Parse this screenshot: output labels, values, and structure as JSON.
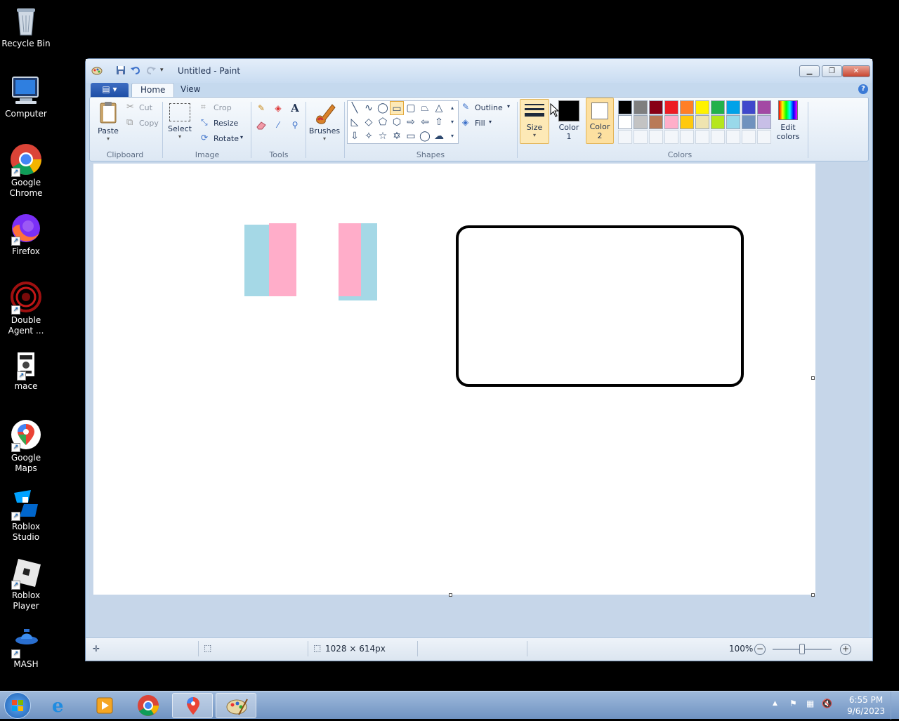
{
  "desktop": {
    "icons": [
      {
        "label": "Recycle Bin"
      },
      {
        "label": "Computer"
      },
      {
        "label": "Google Chrome"
      },
      {
        "label": "Firefox"
      },
      {
        "label": "Double Agent ..."
      },
      {
        "label": "mace"
      },
      {
        "label": "Google Maps"
      },
      {
        "label": "Roblox Studio"
      },
      {
        "label": "Roblox Player"
      },
      {
        "label": "MASH"
      }
    ]
  },
  "window": {
    "title": "Untitled - Paint",
    "tabs": {
      "home": "Home",
      "view": "View"
    }
  },
  "ribbon": {
    "clipboard": {
      "paste": "Paste",
      "cut": "Cut",
      "copy": "Copy",
      "group": "Clipboard"
    },
    "image": {
      "select": "Select",
      "crop": "Crop",
      "resize": "Resize",
      "rotate": "Rotate",
      "group": "Image"
    },
    "tools": {
      "group": "Tools"
    },
    "brushes": {
      "label": "Brushes"
    },
    "shapes": {
      "outline": "Outline",
      "fill": "Fill",
      "group": "Shapes"
    },
    "size": {
      "label": "Size"
    },
    "colors": {
      "color1_line1": "Color",
      "color1_line2": "1",
      "color2_line1": "Color",
      "color2_line2": "2",
      "edit_line1": "Edit",
      "edit_line2": "colors",
      "group": "Colors",
      "color1_value": "#000000",
      "color2_value": "#ffffff",
      "palette_row1": [
        "#000000",
        "#7f7f7f",
        "#880015",
        "#ed1c24",
        "#ff7f27",
        "#fff200",
        "#22b14c",
        "#00a2e8",
        "#3f48cc",
        "#a349a4"
      ],
      "palette_row2": [
        "#ffffff",
        "#c3c3c3",
        "#b97a57",
        "#ffaec9",
        "#ffc90e",
        "#efe4b0",
        "#b5e61d",
        "#99d9ea",
        "#7092be",
        "#c8bfe7"
      ]
    }
  },
  "canvas": {
    "drawing_colors": {
      "blue": "#a5d8e6",
      "pink": "#ffadc9",
      "outline": "#000000"
    }
  },
  "statusbar": {
    "dimensions": "1028 × 614px",
    "zoom": "100%"
  },
  "taskbar": {
    "time": "6:55 PM",
    "date": "9/6/2023"
  }
}
